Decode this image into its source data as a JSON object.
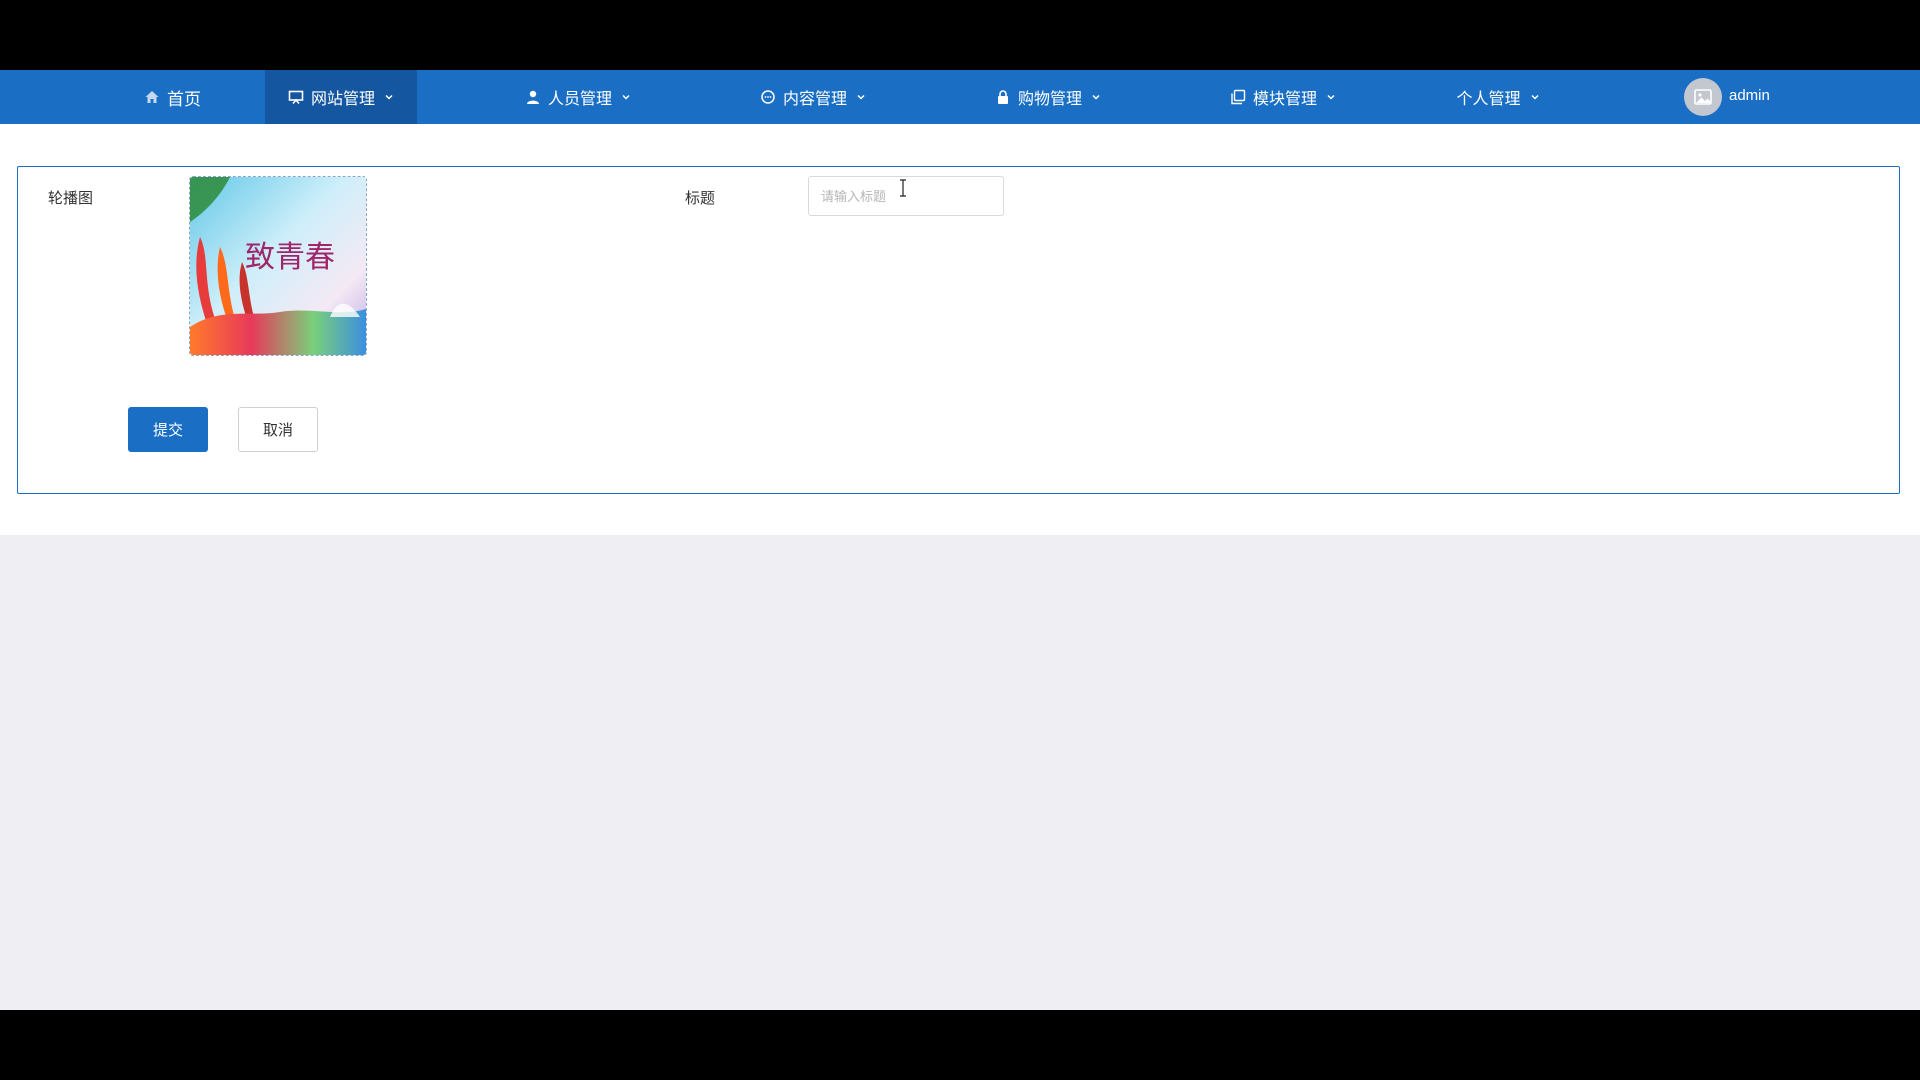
{
  "nav": {
    "items": [
      {
        "label": "首页",
        "icon": "home-icon",
        "dropdown": false
      },
      {
        "label": "网站管理",
        "icon": "monitor-icon",
        "dropdown": true,
        "active": true
      },
      {
        "label": "人员管理",
        "icon": "user-icon",
        "dropdown": true
      },
      {
        "label": "内容管理",
        "icon": "chat-icon",
        "dropdown": true
      },
      {
        "label": "购物管理",
        "icon": "lock-icon",
        "dropdown": true
      },
      {
        "label": "模块管理",
        "icon": "copy-icon",
        "dropdown": true
      },
      {
        "label": "个人管理",
        "icon": "",
        "dropdown": true
      }
    ],
    "user": {
      "name": "admin",
      "avatar_icon": "image-icon"
    },
    "colors": {
      "bar": "#1a6fc5",
      "active": "#1456a0"
    }
  },
  "form": {
    "carousel_label": "轮播图",
    "title_label": "标题",
    "title_value": "",
    "title_placeholder": "请输入标题",
    "carousel_image_text": "致青春",
    "submit_label": "提交",
    "cancel_label": "取消"
  }
}
